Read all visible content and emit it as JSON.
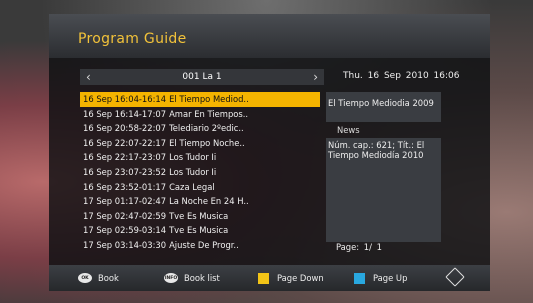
{
  "window": {
    "title": "Program Guide"
  },
  "channel": {
    "name": "001 La 1",
    "prev_arrow": "‹",
    "next_arrow": "›"
  },
  "clock": {
    "day": "Thu.",
    "date": "16 Sep 2010 16:06"
  },
  "programs": [
    {
      "time": "16 Sep 16:04-16:14",
      "title": "El Tiempo Mediod..",
      "selected": true
    },
    {
      "time": "16 Sep 16:14-17:07",
      "title": "Amar En Tiempos..",
      "selected": false
    },
    {
      "time": "16 Sep 20:58-22:07",
      "title": "Telediario 2ºedic..",
      "selected": false
    },
    {
      "time": "16 Sep 22:07-22:17",
      "title": "El Tiempo Noche..",
      "selected": false
    },
    {
      "time": "16 Sep 22:17-23:07",
      "title": "Los Tudor Ii",
      "selected": false
    },
    {
      "time": "16 Sep 23:07-23:52",
      "title": "Los Tudor Ii",
      "selected": false
    },
    {
      "time": "16 Sep 23:52-01:17",
      "title": "Caza Legal",
      "selected": false
    },
    {
      "time": "17 Sep 01:17-02:47",
      "title": "La Noche En 24 H..",
      "selected": false
    },
    {
      "time": "17 Sep 02:47-02:59",
      "title": "Tve Es Musica",
      "selected": false
    },
    {
      "time": "17 Sep 02:59-03:14",
      "title": "Tve Es Musica",
      "selected": false
    },
    {
      "time": "17 Sep 03:14-03:30",
      "title": "Ajuste De Progr..",
      "selected": false
    }
  ],
  "details": {
    "program_title": "El Tiempo Mediodia 2009",
    "section_label": "News",
    "description_line1": "Núm. cap.: 621; Tít.: El",
    "description_line2": "Tiempo Mediodía 2010",
    "page": "Page: 1/ 1"
  },
  "footer": {
    "ok_icon_text": "OK",
    "ok_label": "Book",
    "info_icon_text": "INFO",
    "info_label": "Book list",
    "yellow_label": "Page Down",
    "blue_label": "Page Up"
  },
  "colors": {
    "accent": "#f4b400",
    "yellow_key": "#f2c417",
    "blue_key": "#29a8e0",
    "title": "#f2c23a"
  }
}
